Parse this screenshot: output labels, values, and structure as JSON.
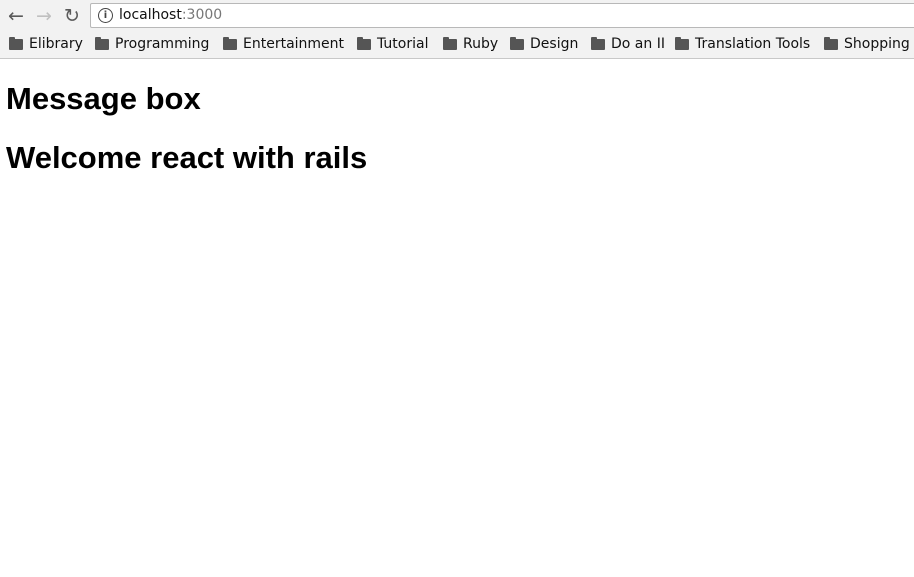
{
  "browser": {
    "url_host": "localhost",
    "url_port": ":3000",
    "bookmarks": [
      "Elibrary",
      "Programming",
      "Entertainment",
      "Tutorial",
      "Ruby",
      "Design",
      "Do an II",
      "Translation Tools",
      "Shopping"
    ]
  },
  "page": {
    "heading1": "Message box",
    "heading2": "Welcome react with rails"
  }
}
